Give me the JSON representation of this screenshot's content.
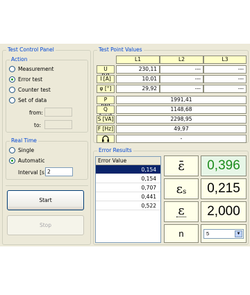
{
  "control_panel": {
    "title": "Test Control Panel",
    "action": {
      "title": "Action",
      "options": [
        "Measurement",
        "Error test",
        "Counter test",
        "Set of data"
      ],
      "selected": 1,
      "from_label": "from:",
      "to_label": "to:"
    },
    "real_time": {
      "title": "Real Time",
      "options": [
        "Single",
        "Automatic"
      ],
      "selected": 1,
      "interval_label": "Interval [s]:",
      "interval_value": "2"
    },
    "start_label": "Start",
    "stop_label": "Stop"
  },
  "test_point": {
    "title": "Test Point Values",
    "columns": [
      "L1",
      "L2",
      "L3"
    ],
    "rows_per_phase": [
      {
        "label": "U [V]",
        "values": [
          "230,11",
          "---",
          "---"
        ]
      },
      {
        "label": "I [A]",
        "values": [
          "10,01",
          "---",
          "---"
        ]
      },
      {
        "label": "φ [°]",
        "values": [
          "29,92",
          "---",
          "---"
        ]
      }
    ],
    "rows_total": [
      {
        "label": "P [W]",
        "value": "1991,41"
      },
      {
        "label": "Q [var]",
        "value": "1148,68"
      },
      {
        "label": "S [VA]",
        "value": "2298,95"
      },
      {
        "label": "F [Hz]",
        "value": "49,97"
      },
      {
        "label": "headphones-icon",
        "value": "-"
      }
    ]
  },
  "error_results": {
    "title": "Error Results",
    "list_header": "Error Value",
    "values": [
      "0,154",
      "0,154",
      "0,707",
      "0,441",
      "0,522"
    ],
    "selected": 0,
    "mean_symbol": "ε̄",
    "mean_value": "0,396",
    "std_symbol": "εs",
    "std_value": "0,215",
    "third_value": "2,000",
    "n_label": "n",
    "n_value": "5"
  }
}
